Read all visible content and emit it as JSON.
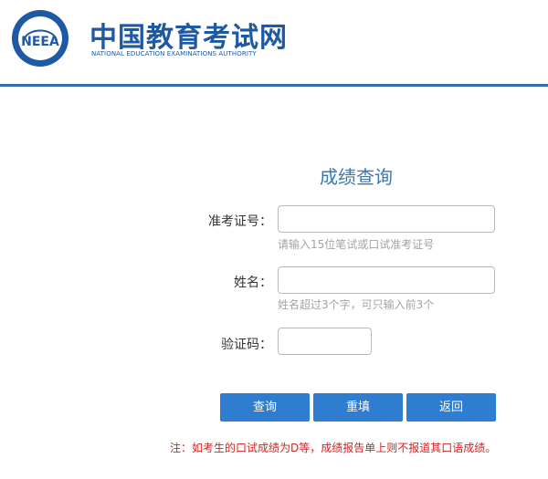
{
  "header": {
    "title": "中国教育考试网",
    "subtitle": "NATIONAL EDUCATION EXAMINATIONS AUTHORITY",
    "logo_text": "NEEA",
    "brand_color": "#1d5aa3"
  },
  "form": {
    "title": "成绩查询",
    "fields": [
      {
        "label": "准考证号：",
        "value": "",
        "hint": "请输入15位笔试或口试准考证号"
      },
      {
        "label": "姓名：",
        "value": "",
        "hint": "姓名超过3个字，可只输入前3个"
      },
      {
        "label": "验证码：",
        "value": ""
      }
    ],
    "buttons": {
      "query": "查询",
      "reset": "重填",
      "back": "返回"
    },
    "note": "注：如考生的口试成绩为D等，成绩报告单上则不报道其口语成绩。"
  },
  "colors": {
    "button": "#2f7dd1",
    "title": "#3b77b3",
    "note": "#d22222",
    "rule": "#2f6cb1"
  }
}
